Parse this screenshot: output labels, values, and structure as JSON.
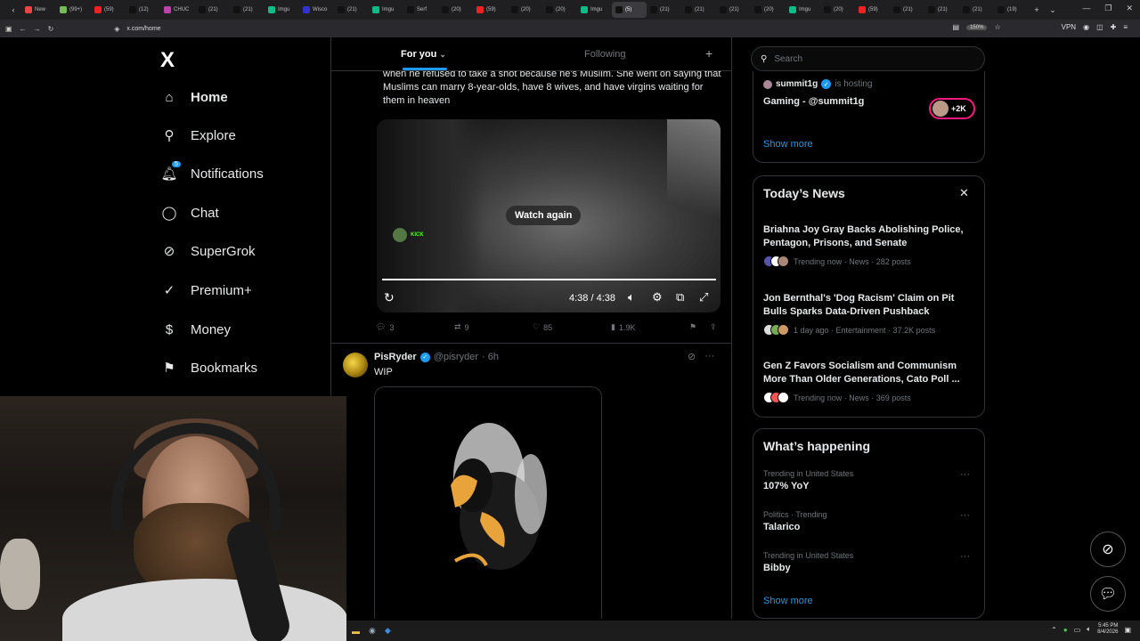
{
  "browser": {
    "tabs": [
      {
        "label": "New",
        "color": "#e44"
      },
      {
        "label": "(99+)",
        "color": "#7b5"
      },
      {
        "label": "(59)",
        "color": "#e22"
      },
      {
        "label": "(12)",
        "color": "#111"
      },
      {
        "label": "CHUC",
        "color": "#b4a"
      },
      {
        "label": "(21)",
        "color": "#111"
      },
      {
        "label": "(21)",
        "color": "#111"
      },
      {
        "label": "Imgu",
        "color": "#1b8"
      },
      {
        "label": "Wisco",
        "color": "#33c"
      },
      {
        "label": "(21)",
        "color": "#111"
      },
      {
        "label": "Imgu",
        "color": "#1b8"
      },
      {
        "label": "Serf",
        "color": "#111"
      },
      {
        "label": "(20)",
        "color": "#111"
      },
      {
        "label": "(59)",
        "color": "#e22"
      },
      {
        "label": "(20)",
        "color": "#111"
      },
      {
        "label": "(20)",
        "color": "#111"
      },
      {
        "label": "Imgu",
        "color": "#1b8"
      },
      {
        "label": "(5)",
        "color": "#111",
        "active": true
      },
      {
        "label": "(21)",
        "color": "#111"
      },
      {
        "label": "(21)",
        "color": "#111"
      },
      {
        "label": "(21)",
        "color": "#111"
      },
      {
        "label": "(20)",
        "color": "#111"
      },
      {
        "label": "Imgu",
        "color": "#1b8"
      },
      {
        "label": "(20)",
        "color": "#111"
      },
      {
        "label": "(59)",
        "color": "#e22"
      },
      {
        "label": "(21)",
        "color": "#111"
      },
      {
        "label": "(21)",
        "color": "#111"
      },
      {
        "label": "(21)",
        "color": "#111"
      },
      {
        "label": "(19)",
        "color": "#111"
      }
    ],
    "url": "x.com/home",
    "zoom": "150%",
    "vpn": "VPN"
  },
  "nav": {
    "logo": "X",
    "items": [
      {
        "label": "Home",
        "icon": "home-icon",
        "glyph": "⌂"
      },
      {
        "label": "Explore",
        "icon": "search-icon",
        "glyph": "⚲"
      },
      {
        "label": "Notifications",
        "icon": "bell-icon",
        "glyph": "🔔︎"
      },
      {
        "label": "Chat",
        "icon": "chat-icon",
        "glyph": "◯"
      },
      {
        "label": "SuperGrok",
        "icon": "grok-icon",
        "glyph": "⊘"
      },
      {
        "label": "Premium+",
        "icon": "verified-icon",
        "glyph": "✓"
      },
      {
        "label": "Money",
        "icon": "money-icon",
        "glyph": "$"
      },
      {
        "label": "Bookmarks",
        "icon": "bookmark-icon",
        "glyph": "⚑"
      }
    ],
    "notifications_badge": "5"
  },
  "feed": {
    "tab_foryou": "For you",
    "tab_following": "Following",
    "tweet1": {
      "text": "when he refused to take a shot because he's Muslim. She went on saying that Muslims can marry 8-year-olds, have 8 wives, and have virgins waiting for them in heaven",
      "watch_again": "Watch again",
      "kick_label": "KICK",
      "time": "4:38 / 4:38",
      "replies": "3",
      "reposts": "9",
      "likes": "85",
      "views": "1.9K"
    },
    "tweet2": {
      "name": "PisRyder",
      "handle": "@pisryder",
      "time": "· 6h",
      "text": "WIP"
    }
  },
  "sidebar": {
    "search_placeholder": "Search",
    "space": {
      "host": "summit1g",
      "hosting": "is hosting",
      "title": "Gaming - @summit1g",
      "listeners": "+2K",
      "show_more": "Show more"
    },
    "news": {
      "title": "Today’s News",
      "items": [
        {
          "title": "Briahna Joy Gray Backs Abolishing Police, Pentagon, Prisons, and Senate",
          "meta": "Trending now · News · 282 posts"
        },
        {
          "title": "Jon Bernthal's 'Dog Racism' Claim on Pit Bulls Sparks Data-Driven Pushback",
          "meta": "1 day ago · Entertainment · 37.2K posts"
        },
        {
          "title": "Gen Z Favors Socialism and Communism More Than Older Generations, Cato Poll ...",
          "meta": "Trending now · News · 369 posts"
        }
      ]
    },
    "happening": {
      "title": "What’s happening",
      "items": [
        {
          "context": "Trending in United States",
          "name": "107% YoY"
        },
        {
          "context": "Politics · Trending",
          "name": "Talarico"
        },
        {
          "context": "Trending in United States",
          "name": "Bibby"
        }
      ],
      "show_more": "Show more"
    }
  },
  "taskbar": {
    "time": "5:45 PM",
    "date": "8/4/2026"
  }
}
